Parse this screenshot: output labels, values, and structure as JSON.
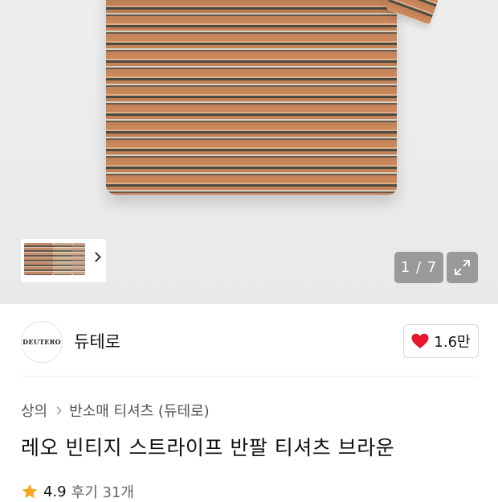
{
  "gallery": {
    "pager_text": "1 / 7",
    "accent_shirt_color": "#c9875a"
  },
  "brand": {
    "logo_text": "DEUTERO",
    "name": "듀테로",
    "like_count": "1.6만",
    "like_color": "#e8162e"
  },
  "breadcrumb": {
    "items": [
      "상의",
      "반소매 티셔츠 (듀테로)"
    ]
  },
  "product": {
    "title": "레오 빈티지 스트라이프 반팔 티셔츠 브라운"
  },
  "rating": {
    "score": "4.9",
    "reviews": "후기 31개",
    "star_color": "#f5a623"
  }
}
